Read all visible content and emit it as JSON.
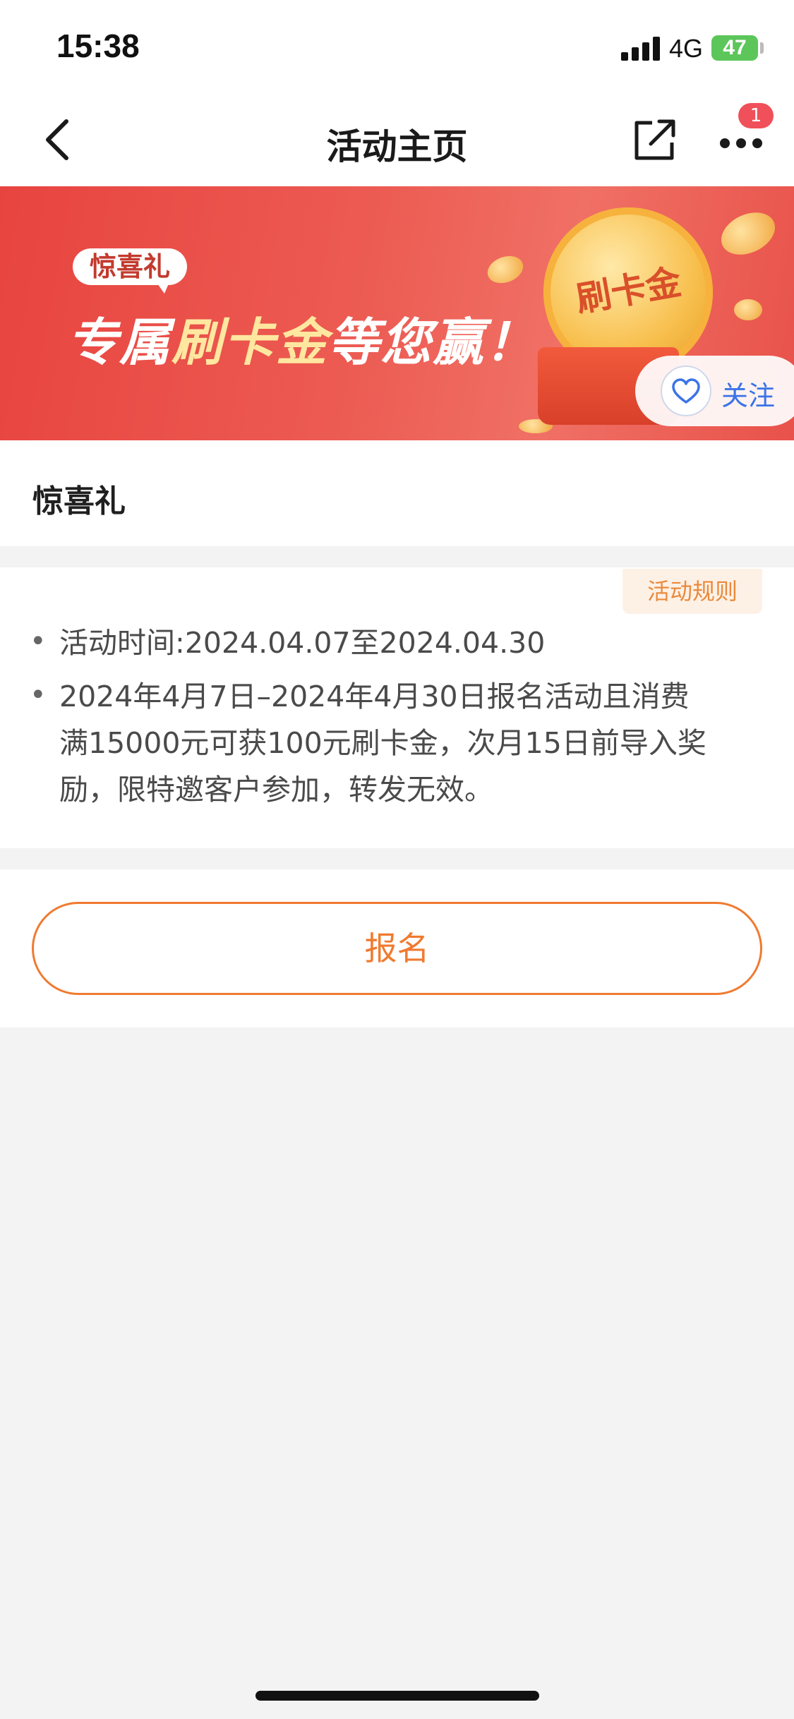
{
  "status_bar": {
    "time": "15:38",
    "network": "4G",
    "battery": "47"
  },
  "nav": {
    "title": "活动主页",
    "notification_count": "1",
    "icons": [
      "chevron-left-icon",
      "share-icon",
      "more-icon"
    ]
  },
  "banner": {
    "tag": "惊喜礼",
    "headline_pre": "专属",
    "headline_highlight": "刷卡金",
    "headline_post": "等您赢！",
    "coin_text": "刷卡金",
    "follow_label": "关注"
  },
  "activity": {
    "title": "惊喜礼",
    "rules_button": "活动规则",
    "time_line": "活动时间:2024.04.07至2024.04.30",
    "detail_lines": [
      "2024年4月7日–2024年4月30日报名活动且消费",
      "满15000元可获100元刷卡金，次月15日前导入奖",
      "励，限特邀客户参加，转发无效。"
    ]
  },
  "signup": {
    "label": "报名"
  },
  "colors": {
    "accent": "#f07a30",
    "banner_red": "#e8443f",
    "follow_blue": "#3b73e8",
    "badge_red": "#f0505a"
  }
}
